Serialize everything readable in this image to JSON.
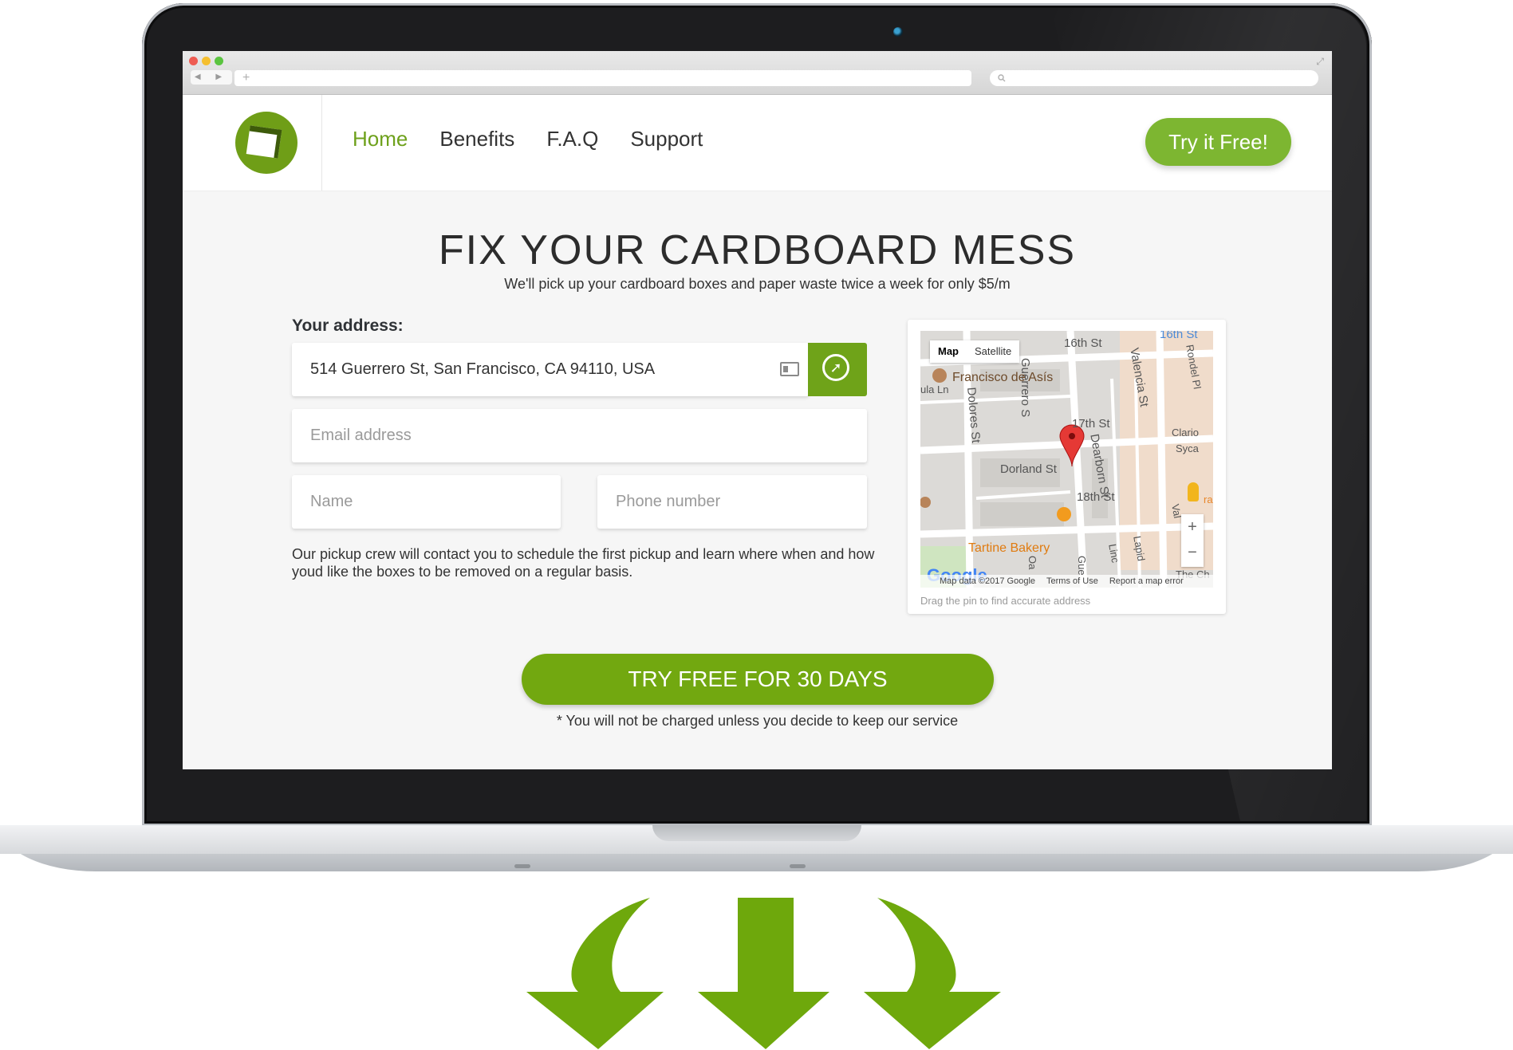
{
  "browser": {
    "nav_arrows": "◀ ▶",
    "new_tab": "+",
    "search_icon": "magnifier-icon",
    "traffic_lights": [
      "#ee5c52",
      "#f5bf2f",
      "#5ac43f"
    ]
  },
  "header": {
    "nav": [
      {
        "label": "Home",
        "active": true
      },
      {
        "label": "Benefits"
      },
      {
        "label": "F.A.Q"
      },
      {
        "label": "Support"
      }
    ],
    "cta_label": "Try it Free!",
    "accent_color": "#7db631"
  },
  "hero": {
    "title": "FIX YOUR CARDBOARD MESS",
    "subtitle": "We'll pick up your cardboard boxes and paper waste twice a week for only $5/m"
  },
  "form": {
    "address_label": "Your address:",
    "address_value": "514 Guerrero St, San Francisco, CA 94110, USA",
    "email_placeholder": "Email address",
    "name_placeholder": "Name",
    "phone_placeholder": "Phone number",
    "note": "Our pickup crew will contact you to schedule the first pickup and learn where when and how youd like the boxes to be removed on a regular basis."
  },
  "map": {
    "tab_map": "Map",
    "tab_satellite": "Satellite",
    "zoom_in": "+",
    "zoom_out": "−",
    "footer_data": "Map data ©2017 Google",
    "footer_terms": "Terms of Use",
    "footer_report": "Report a map error",
    "google_logo": "Google",
    "hint": "Drag the pin to find accurate address",
    "streets": {
      "s16th": "16th St",
      "s16th_b": "16th St",
      "s17th": "17th St",
      "s18th": "18th St",
      "guerrero": "Guerrero S",
      "valencia": "Valencia St",
      "rondel": "Rondel Pl",
      "dolores": "Dolores St",
      "dearborn": "Dearborn St",
      "dorland": "Dorland St",
      "ulaln": "ula Ln",
      "clario": "Clario",
      "syca": "Syca",
      "val": "Val",
      "lapid": "Lapid",
      "linc": "Linc",
      "oa": "Oa",
      "gue": "Gue",
      "thech": "The Ch",
      "ra": "ra"
    },
    "pois": {
      "francisco": "Francisco de Asís",
      "tartine": "Tartine Bakery"
    }
  },
  "cta": {
    "label": "TRY FREE FOR 30 DAYS",
    "disclaimer": "* You will not be charged unless you decide to keep our service"
  }
}
